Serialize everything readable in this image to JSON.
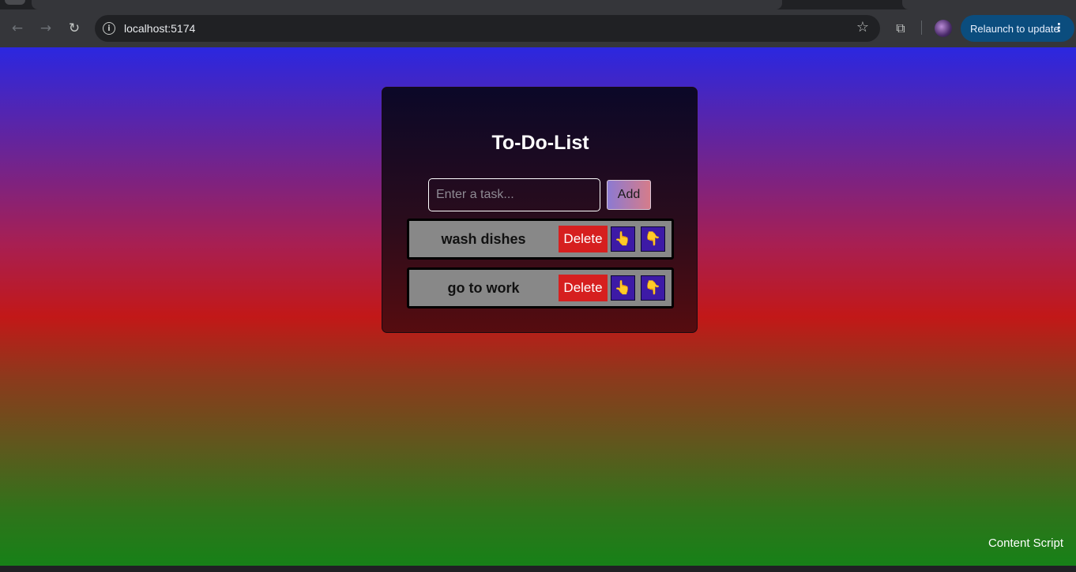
{
  "browser": {
    "url": "localhost:5174",
    "relaunch_label": "Relaunch to update",
    "icons": {
      "back": "←",
      "forward": "→",
      "reload": "↻",
      "info": "i",
      "star": "☆",
      "extensions": "⧉",
      "menu": "⋮"
    }
  },
  "app": {
    "title": "To-Do-List",
    "input_placeholder": "Enter a task...",
    "input_value": "",
    "add_label": "Add",
    "tasks": [
      {
        "text": "wash dishes",
        "delete_label": "Delete",
        "up_icon": "👆",
        "down_icon": "👇"
      },
      {
        "text": "go to work",
        "delete_label": "Delete",
        "up_icon": "👆",
        "down_icon": "👇"
      }
    ]
  },
  "overlay": {
    "content_script_label": "Content Script"
  },
  "colors": {
    "gradient_top": "#2b27e0",
    "gradient_mid": "#c21818",
    "gradient_bottom": "#178118",
    "delete_red": "#d61f1f",
    "move_button": "#3d1aa6",
    "task_bg": "#888888"
  }
}
